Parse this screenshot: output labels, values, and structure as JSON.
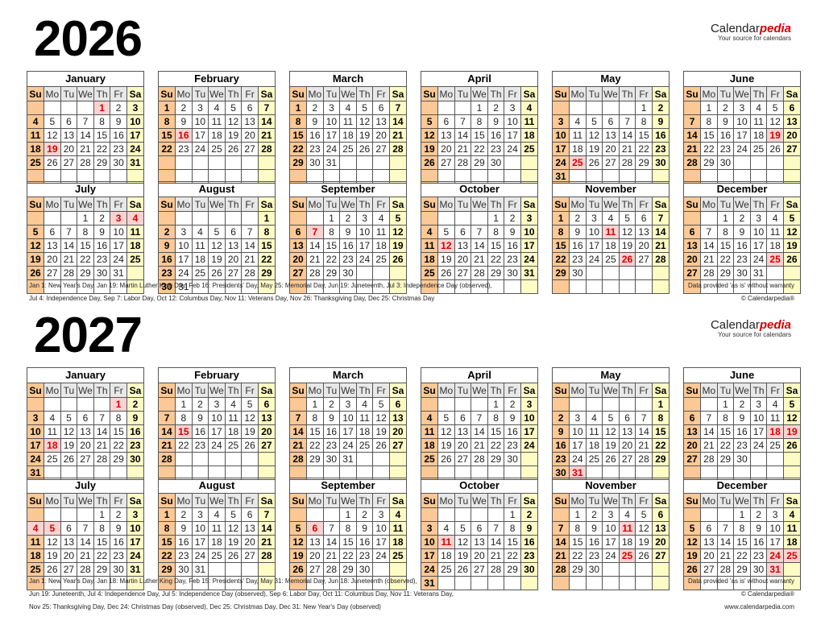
{
  "brand": {
    "name_plain": "Calendar",
    "name_accent": "pedia",
    "tagline": "Your source for calendars"
  },
  "weekday_headers": [
    "Su",
    "Mo",
    "Tu",
    "We",
    "Th",
    "Fr",
    "Sa"
  ],
  "years": [
    {
      "year": "2026",
      "months": [
        {
          "name": "January",
          "start": 4,
          "days": 31,
          "holidays": [
            1,
            19
          ]
        },
        {
          "name": "February",
          "start": 0,
          "days": 28,
          "holidays": [
            16
          ]
        },
        {
          "name": "March",
          "start": 0,
          "days": 31,
          "holidays": []
        },
        {
          "name": "April",
          "start": 3,
          "days": 30,
          "holidays": []
        },
        {
          "name": "May",
          "start": 5,
          "days": 31,
          "holidays": [
            25
          ]
        },
        {
          "name": "June",
          "start": 1,
          "days": 30,
          "holidays": [
            19
          ]
        },
        {
          "name": "July",
          "start": 3,
          "days": 31,
          "holidays": [
            3,
            4
          ]
        },
        {
          "name": "August",
          "start": 6,
          "days": 31,
          "holidays": []
        },
        {
          "name": "September",
          "start": 2,
          "days": 30,
          "holidays": [
            7
          ]
        },
        {
          "name": "October",
          "start": 4,
          "days": 31,
          "holidays": [
            12
          ]
        },
        {
          "name": "November",
          "start": 0,
          "days": 30,
          "holidays": [
            11,
            26
          ]
        },
        {
          "name": "December",
          "start": 2,
          "days": 31,
          "holidays": [
            25
          ]
        }
      ],
      "notes": [
        "Jan 1: New Year's Day, Jan 19: Martin Luther King Day, Feb 16: Presidents' Day, May 25: Memorial Day, Jun 19: Juneteenth, Jul 3: Independence Day (observed),",
        "Jul 4: Independence Day, Sep 7: Labor Day, Oct 12: Columbus Day, Nov 11: Veterans Day, Nov 26: Thanksgiving Day, Dec 25: Christmas Day"
      ],
      "right_notes": [
        "Data provided 'as is' without warranty",
        "© Calendarpedia®"
      ]
    },
    {
      "year": "2027",
      "months": [
        {
          "name": "January",
          "start": 5,
          "days": 31,
          "holidays": [
            1,
            18
          ]
        },
        {
          "name": "February",
          "start": 1,
          "days": 28,
          "holidays": [
            15
          ]
        },
        {
          "name": "March",
          "start": 1,
          "days": 31,
          "holidays": []
        },
        {
          "name": "April",
          "start": 4,
          "days": 30,
          "holidays": []
        },
        {
          "name": "May",
          "start": 6,
          "days": 31,
          "holidays": [
            31
          ]
        },
        {
          "name": "June",
          "start": 2,
          "days": 30,
          "holidays": [
            18,
            19
          ]
        },
        {
          "name": "July",
          "start": 4,
          "days": 31,
          "holidays": [
            4,
            5
          ]
        },
        {
          "name": "August",
          "start": 0,
          "days": 31,
          "holidays": []
        },
        {
          "name": "September",
          "start": 3,
          "days": 30,
          "holidays": [
            6
          ]
        },
        {
          "name": "October",
          "start": 5,
          "days": 31,
          "holidays": [
            11
          ]
        },
        {
          "name": "November",
          "start": 1,
          "days": 30,
          "holidays": [
            11,
            25
          ]
        },
        {
          "name": "December",
          "start": 3,
          "days": 31,
          "holidays": [
            24,
            25,
            31
          ]
        }
      ],
      "notes": [
        "Jan 1: New Year's Day, Jan 18: Martin Luther King Day, Feb 15: Presidents' Day, May 31: Memorial Day, Jun 18: Juneteenth (observed),",
        "Jun 19: Juneteenth, Jul 4: Independence Day, Jul 5: Independence Day (observed), Sep 6: Labor Day, Oct 11: Columbus Day, Nov 11: Veterans Day,",
        "Nov 25: Thanksgiving Day, Dec 24: Christmas Day (observed), Dec 25: Christmas Day, Dec 31: New Year's Day (observed)"
      ],
      "right_notes": [
        "Data provided 'as is' without warranty",
        "© Calendarpedia®",
        "www.calendarpedia.com"
      ]
    }
  ]
}
